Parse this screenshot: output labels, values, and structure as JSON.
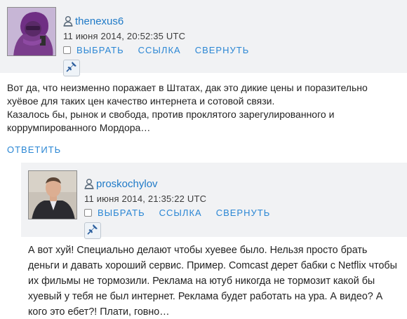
{
  "comments": [
    {
      "username": "thenexus6",
      "date": "11 июня 2014, 20:52:35 UTC",
      "actions": [
        "ВЫБРАТЬ",
        "ССЫЛКА",
        "СВЕРНУТЬ"
      ],
      "paragraphs": [
        "Вот да, что неизменно поражает в Штатах, дак это дикие цены и поразительно хуёвое для таких цен качество интернета и сотовой связи.",
        "Казалось бы, рынок и свобода, против проклятого зарегулированного и коррумпированного Мордора…"
      ],
      "reply_label": "ОТВЕТИТЬ"
    },
    {
      "username": "proskochylov",
      "date": "11 июня 2014, 21:35:22 UTC",
      "actions": [
        "ВЫБРАТЬ",
        "ССЫЛКА",
        "СВЕРНУТЬ"
      ],
      "paragraphs": [
        "А вот хуй! Специально делают чтобы хуевее было. Нельзя просто брать деньги и давать хороший сервис. Пример. Comcast дерет бабки с Netflix чтобы их фильмы не тормозили. Реклама на ютуб никогда не тормозит какой бы хуевый у тебя не был интернет. Реклама будет работать на ура. А видео? А кого это ебет?! Плати, говно…"
      ]
    }
  ],
  "icons": {
    "user": "user-icon",
    "pin": "pushpin-icon"
  },
  "colors": {
    "link": "#2a86d4",
    "username": "#1f7ac7",
    "header_bg": "#f1f2f4",
    "text": "#222222"
  }
}
